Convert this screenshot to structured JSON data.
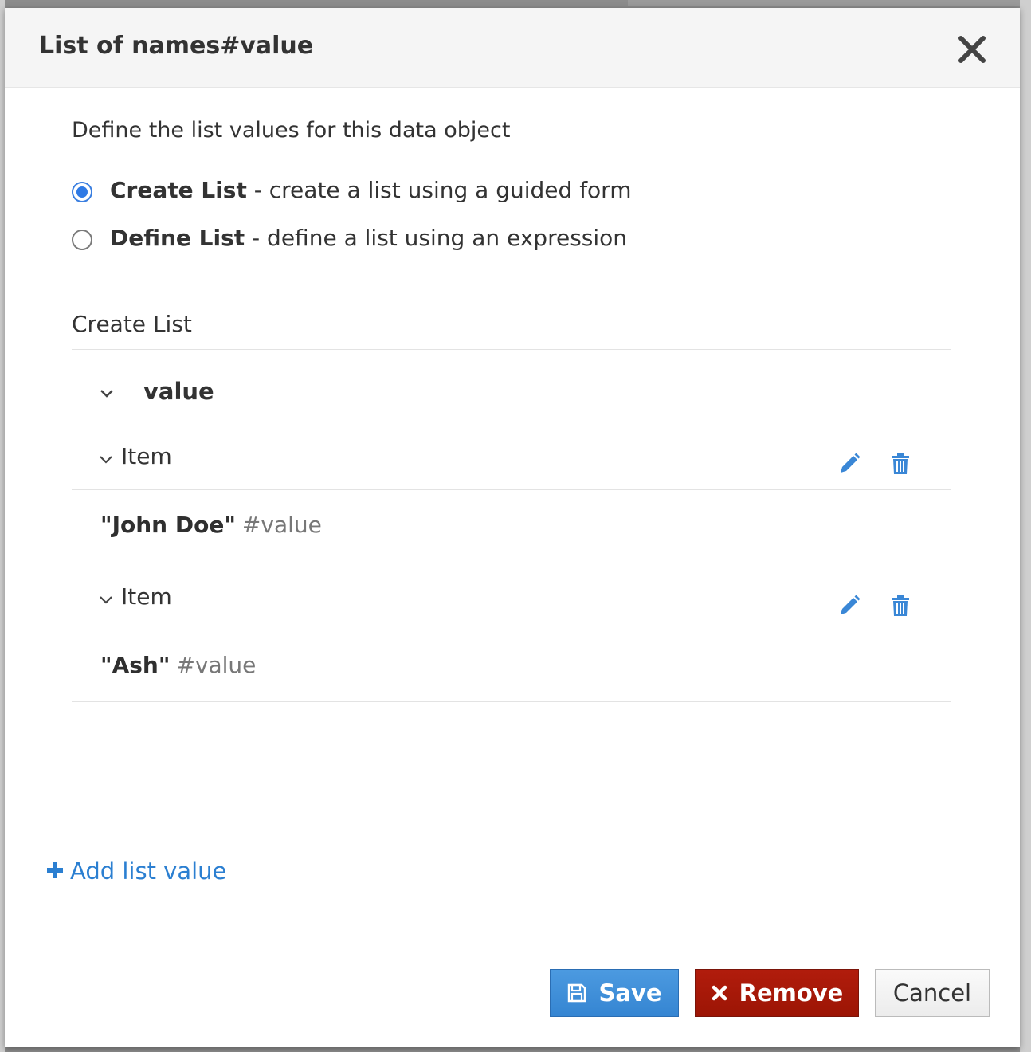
{
  "dialog": {
    "title": "List of names#value"
  },
  "intro": "Define the list values for this data object",
  "options": [
    {
      "title": "Create List",
      "desc": " - create a list using a guided form",
      "checked": true
    },
    {
      "title": "Define List",
      "desc": " - define a list using an expression",
      "checked": false
    }
  ],
  "section": {
    "title": "Create List",
    "group": "value",
    "items": [
      {
        "label": "Item",
        "value": "\"John Doe\"",
        "suffix": "#value"
      },
      {
        "label": "Item",
        "value": "\"Ash\"",
        "suffix": "#value"
      }
    ]
  },
  "actions": {
    "add_label": "Add list value",
    "save_label": "Save",
    "remove_label": "Remove",
    "cancel_label": "Cancel"
  },
  "colors": {
    "accent": "#2b7fd1",
    "danger": "#a3180a",
    "radio": "#2f7ae5"
  },
  "icons": {
    "close": "close-icon",
    "chevron": "chevron-down-icon",
    "edit": "pencil-icon",
    "delete": "trash-icon",
    "add": "plus-icon",
    "save": "floppy-disk-icon",
    "remove": "x-icon"
  }
}
